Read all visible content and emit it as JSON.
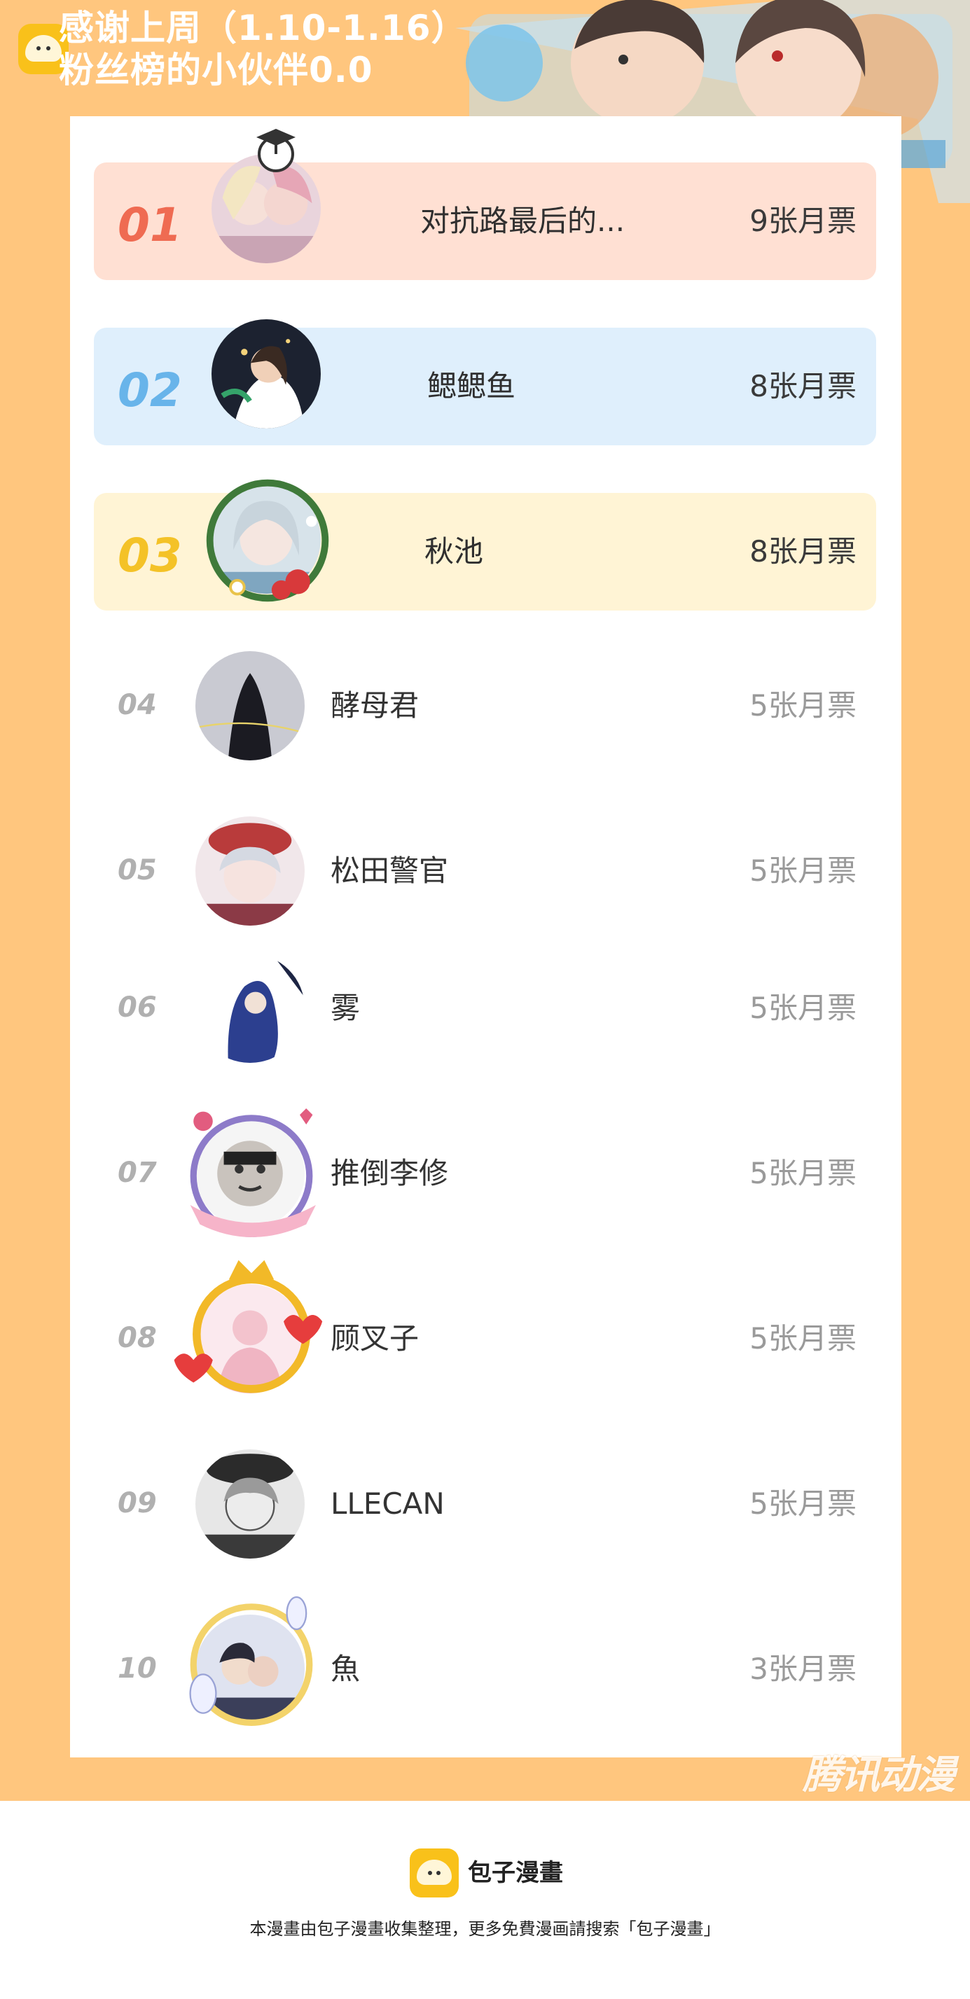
{
  "banner": {
    "title_line1": "感谢上周（1.10-1.16）",
    "title_line2": "粉丝榜的小伙伴0.0"
  },
  "ranking": [
    {
      "rank": "01",
      "name": "对抗路最后的...",
      "votes": "9张月票",
      "avatar_icon": "avatar-blonde-girls"
    },
    {
      "rank": "02",
      "name": "鳃鳃鱼",
      "votes": "8张月票",
      "avatar_icon": "avatar-night-figure"
    },
    {
      "rank": "03",
      "name": "秋池",
      "votes": "8张月票",
      "avatar_icon": "avatar-silver-hair-girl"
    },
    {
      "rank": "04",
      "name": "酵母君",
      "votes": "5张月票",
      "avatar_icon": "avatar-dark-cloaked-figure"
    },
    {
      "rank": "05",
      "name": "松田警官",
      "votes": "5张月票",
      "avatar_icon": "avatar-red-hat-girl"
    },
    {
      "rank": "06",
      "name": "雾",
      "votes": "5张月票",
      "avatar_icon": "avatar-blue-hair-figure"
    },
    {
      "rank": "07",
      "name": "推倒李修",
      "votes": "5张月票",
      "avatar_icon": "avatar-meme-face"
    },
    {
      "rank": "08",
      "name": "顾叉子",
      "votes": "5张月票",
      "avatar_icon": "avatar-pink-silhouette"
    },
    {
      "rank": "09",
      "name": "LLECAN",
      "votes": "5张月票",
      "avatar_icon": "avatar-grey-hair-man"
    },
    {
      "rank": "10",
      "name": "魚",
      "votes": "3张月票",
      "avatar_icon": "avatar-couple"
    }
  ],
  "watermark": "腾讯动漫",
  "footer": {
    "brand": "包子漫畫",
    "note": "本漫畫由包子漫畫收集整理，更多免費漫画請搜索「包子漫畫」"
  },
  "colors": {
    "page_background": "#ffc67e",
    "rank1_background": "#ffe0d3",
    "rank2_background": "#dfeffc",
    "rank3_background": "#fff4d5",
    "rank1_accent": "#ef6b52",
    "rank2_accent": "#68b4ea",
    "rank3_accent": "#f4c227",
    "brand_yellow": "#f9c11a"
  }
}
